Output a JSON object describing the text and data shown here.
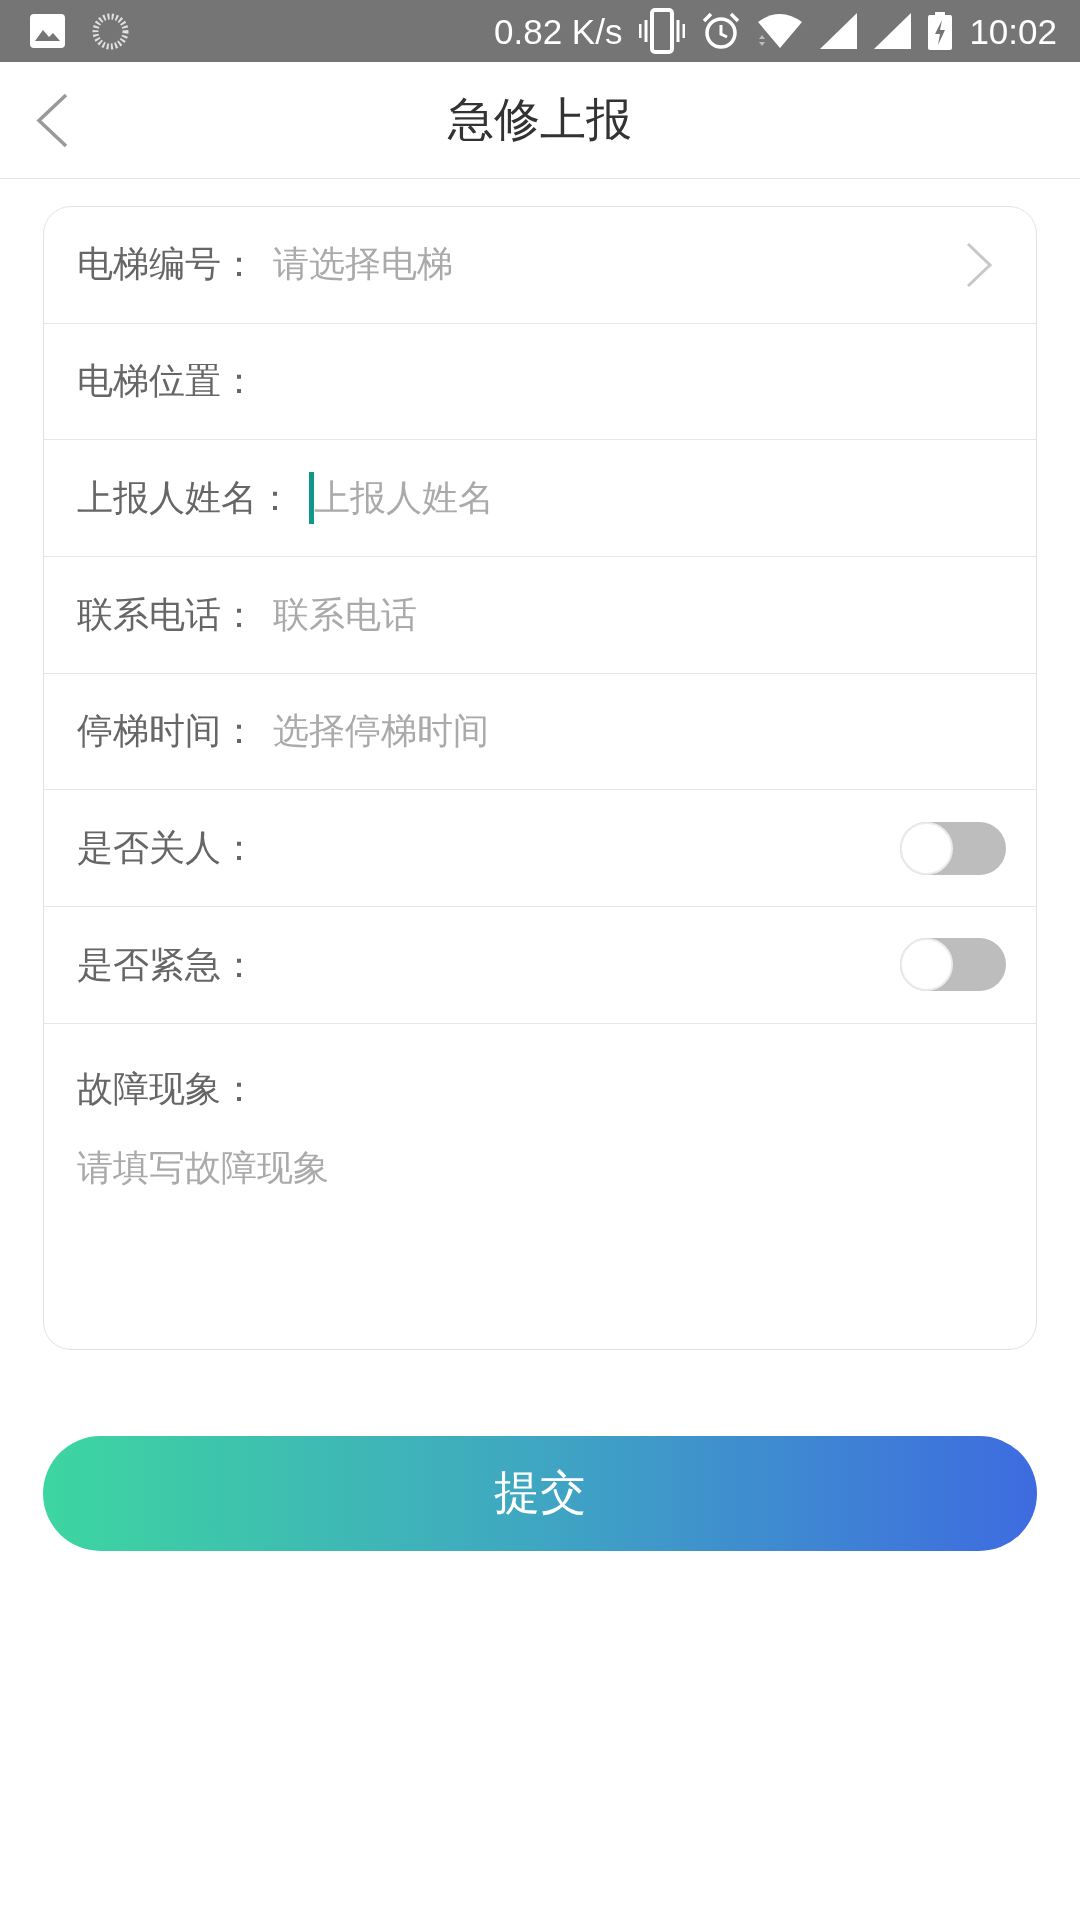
{
  "status_bar": {
    "net_speed": "0.82 K/s",
    "time": "10:02"
  },
  "header": {
    "title": "急修上报"
  },
  "form": {
    "rows": [
      {
        "kind": "select",
        "label": "电梯编号：",
        "placeholder": "请选择电梯"
      },
      {
        "kind": "display",
        "label": "电梯位置："
      },
      {
        "kind": "input",
        "label": "上报人姓名：",
        "placeholder": "上报人姓名",
        "focused": true
      },
      {
        "kind": "input",
        "label": "联系电话：",
        "placeholder": "联系电话",
        "focused": false
      },
      {
        "kind": "picker",
        "label": "停梯时间：",
        "placeholder": "选择停梯时间"
      },
      {
        "kind": "switch",
        "label": "是否关人：",
        "on": false
      },
      {
        "kind": "switch",
        "label": "是否紧急：",
        "on": false
      }
    ],
    "description": {
      "label": "故障现象：",
      "placeholder": "请填写故障现象"
    }
  },
  "submit_button": {
    "label": "提交"
  }
}
